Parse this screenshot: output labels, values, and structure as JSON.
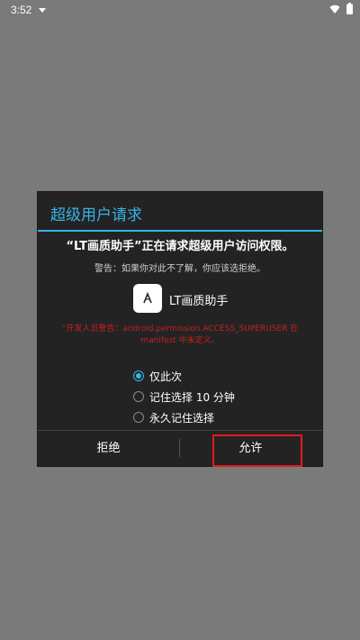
{
  "status_bar": {
    "time": "3:52"
  },
  "dialog": {
    "title": "超级用户请求",
    "headline": "“LT画质助手”正在请求超级用户访问权限。",
    "warning": "警告：如果你对此不了解，你应该选拒绝。",
    "app_name": "LT画质助手",
    "developer_warning": "“开发人员警告：android.permission.ACCESS_SUPERUSER 在 manifest 中未定义。",
    "options": [
      {
        "label": "仅此次",
        "checked": true
      },
      {
        "label": "记住选择 10 分钟",
        "checked": false
      },
      {
        "label": "永久记住选择",
        "checked": false
      }
    ],
    "deny_label": "拒绝",
    "allow_label": "允许"
  },
  "colors": {
    "accent": "#33b5e5",
    "warning_text": "#c62020",
    "highlight": "#e21c1c"
  }
}
